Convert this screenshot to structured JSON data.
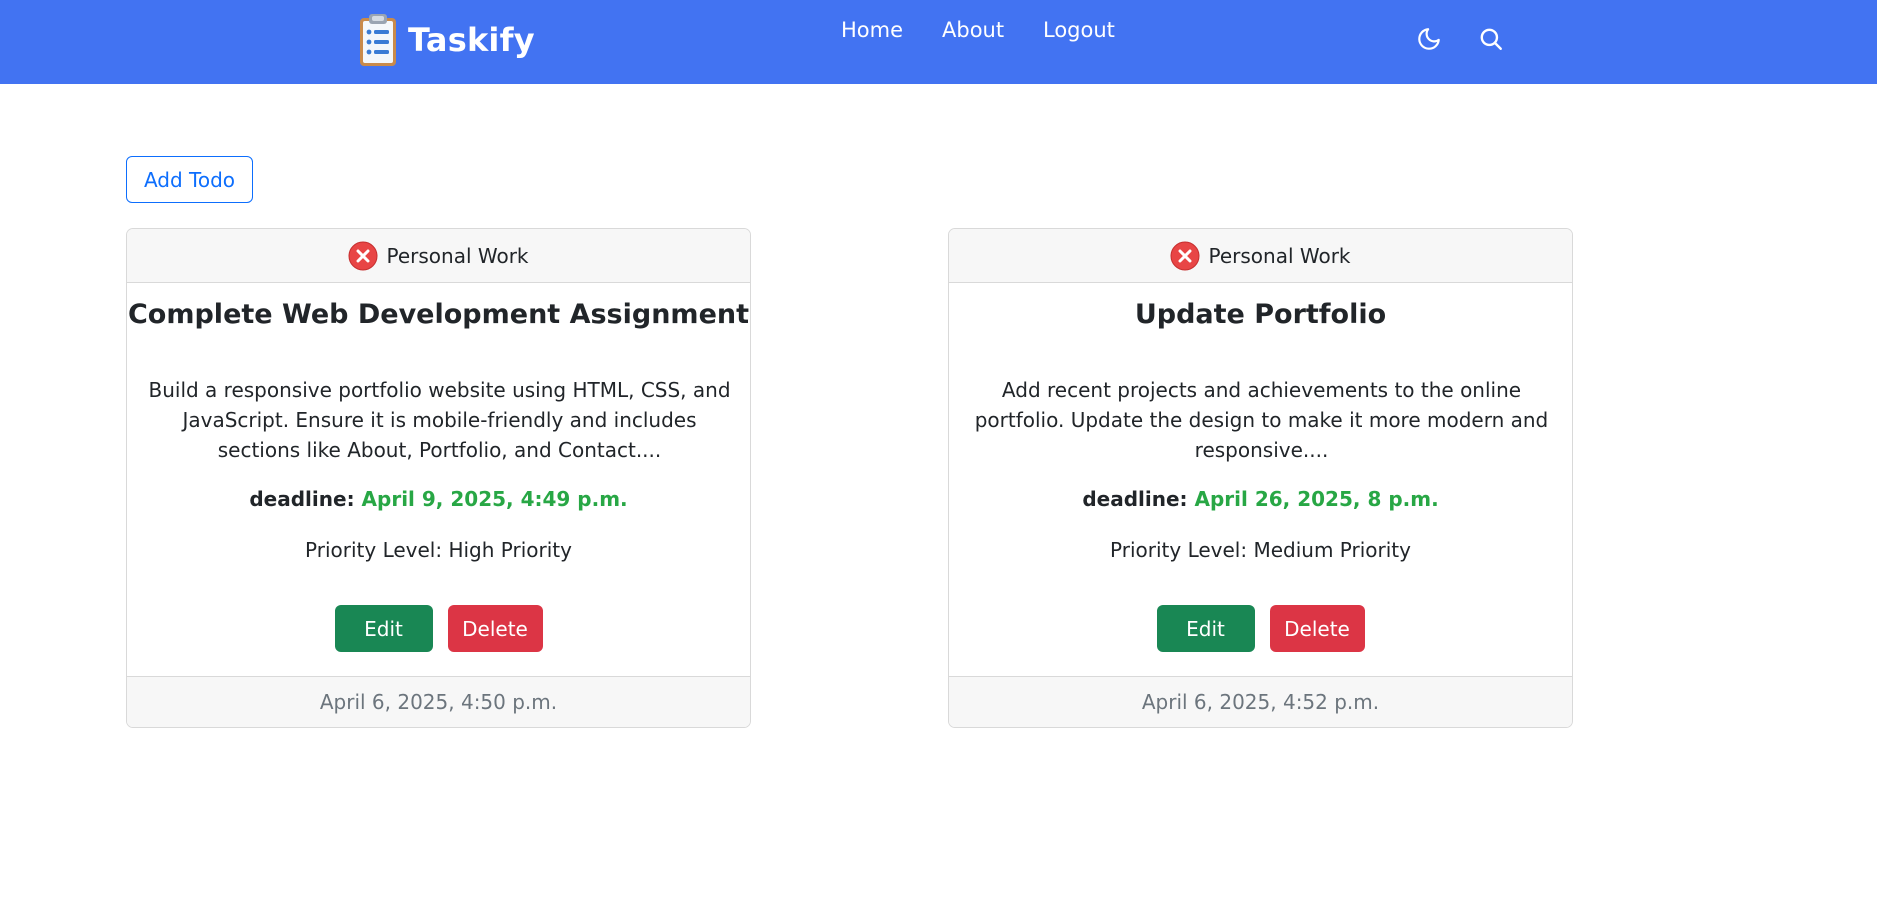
{
  "brand": {
    "name": "Taskify",
    "icon": "clipboard-list-icon"
  },
  "nav": [
    {
      "label": "Home"
    },
    {
      "label": "About"
    },
    {
      "label": "Logout"
    }
  ],
  "toolbar": {
    "theme_icon": "moon-icon",
    "search_icon": "search-icon"
  },
  "add_todo_label": "Add Todo",
  "colors": {
    "navbar": "#4273f2",
    "primary": "#0d6efd",
    "success": "#198754",
    "danger": "#dc3545",
    "deadline": "#28a745"
  },
  "todos": [
    {
      "status_icon": "x-circle-icon",
      "category": "Personal Work",
      "title": "Complete Web Development Assignment",
      "description": "Build a responsive portfolio website using HTML, CSS, and JavaScript. Ensure it is mobile-friendly and includes sections like About, Portfolio, and Contact....",
      "deadline_label": "deadline:",
      "deadline": "April 9, 2025, 4:49 p.m.",
      "priority": "Priority Level: High Priority",
      "edit_label": "Edit",
      "delete_label": "Delete",
      "created": "April 6, 2025, 4:50 p.m."
    },
    {
      "status_icon": "x-circle-icon",
      "category": "Personal Work",
      "title": "Update Portfolio",
      "description": "Add recent projects and achievements to the online portfolio. Update the design to make it more modern and responsive....",
      "deadline_label": "deadline:",
      "deadline": "April 26, 2025, 8 p.m.",
      "priority": "Priority Level: Medium Priority",
      "edit_label": "Edit",
      "delete_label": "Delete",
      "created": "April 6, 2025, 4:52 p.m."
    }
  ]
}
